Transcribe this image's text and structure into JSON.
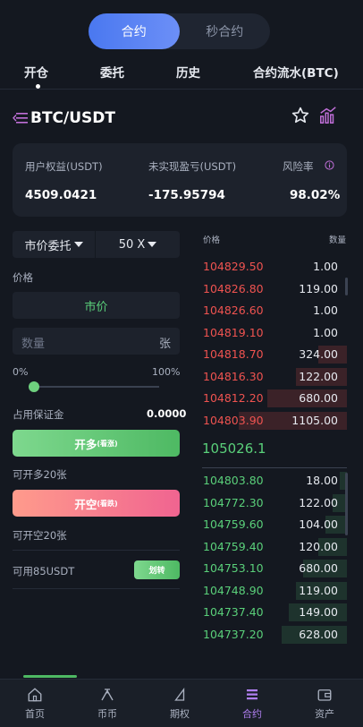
{
  "segment": {
    "options": [
      "合约",
      "秒合约"
    ],
    "active": 0
  },
  "tabs": [
    "开仓",
    "委托",
    "历史",
    "合约流水(BTC)"
  ],
  "pair": {
    "title": "BTC/USDT"
  },
  "account": {
    "equity_label": "用户权益(USDT)",
    "equity_value": "4509.0421",
    "pnl_label": "未实现盈亏(USDT)",
    "pnl_value": "-175.95794",
    "risk_label": "风险率",
    "risk_value": "98.02%"
  },
  "form": {
    "order_type": "市价委托",
    "leverage": "50 X",
    "price_label": "价格",
    "market_label": "市价",
    "qty_placeholder": "数量",
    "qty_unit": "张",
    "pct_min": "0%",
    "pct_max": "100%",
    "slider_fraction": 0.0,
    "margin_label": "占用保证金",
    "margin_value": "0.0000",
    "long_label": "开多",
    "long_sub": "(看涨)",
    "long_cap": "可开多20张",
    "short_label": "开空",
    "short_sub": "(看跌)",
    "short_cap": "可开空20张",
    "avail_label": "可用85USDT",
    "transfer_label": "划转"
  },
  "orderbook": {
    "price_header": "价格",
    "qty_header": "数量",
    "asks": [
      {
        "price": "104829.50",
        "qty": "1.00",
        "depth": 0.0
      },
      {
        "price": "104826.80",
        "qty": "119.00",
        "depth": 0.0
      },
      {
        "price": "104826.60",
        "qty": "1.00",
        "depth": 0.0
      },
      {
        "price": "104819.10",
        "qty": "1.00",
        "depth": 0.0
      },
      {
        "price": "104818.70",
        "qty": "324.00",
        "depth": 0.2
      },
      {
        "price": "104816.30",
        "qty": "122.00",
        "depth": 0.35
      },
      {
        "price": "104812.20",
        "qty": "680.00",
        "depth": 0.55
      },
      {
        "price": "104803.90",
        "qty": "1105.00",
        "depth": 0.75
      }
    ],
    "last_price": "105026.1",
    "bids": [
      {
        "price": "104803.80",
        "qty": "18.00",
        "depth": 0.05
      },
      {
        "price": "104772.30",
        "qty": "122.00",
        "depth": 0.1
      },
      {
        "price": "104759.60",
        "qty": "104.00",
        "depth": 0.15
      },
      {
        "price": "104759.40",
        "qty": "120.00",
        "depth": 0.2
      },
      {
        "price": "104753.10",
        "qty": "680.00",
        "depth": 0.3
      },
      {
        "price": "104748.90",
        "qty": "119.00",
        "depth": 0.35
      },
      {
        "price": "104737.40",
        "qty": "149.00",
        "depth": 0.4
      },
      {
        "price": "104737.20",
        "qty": "628.00",
        "depth": 0.45
      }
    ]
  },
  "bottom_nav": [
    {
      "label": "首页",
      "icon": "home-icon"
    },
    {
      "label": "币币",
      "icon": "coin-icon"
    },
    {
      "label": "期权",
      "icon": "option-icon"
    },
    {
      "label": "合约",
      "icon": "contract-icon",
      "active": true
    },
    {
      "label": "资产",
      "icon": "wallet-icon"
    }
  ],
  "colors": {
    "accent": "#4a78f0",
    "up": "#5ad07a",
    "down": "#ef5350",
    "active_nav": "#b07ff0"
  }
}
